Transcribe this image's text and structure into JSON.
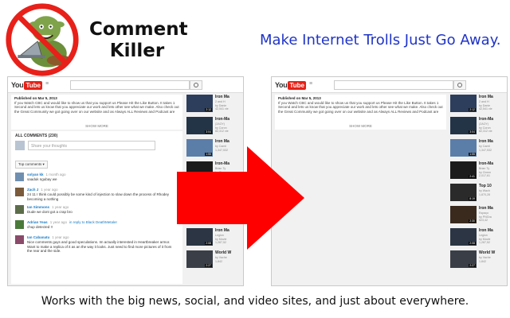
{
  "header": {
    "brand_line1": "Comment",
    "brand_line2": "Killer",
    "tagline": "Make Internet Trolls Just Go Away."
  },
  "footer": "Works with the big news, social, and video sites, and just about everywhere.",
  "colors": {
    "tagline": "#1f34c8",
    "arrow": "#ff0000",
    "youtube_red": "#e62117",
    "link_blue": "#167ac6",
    "no_sign": "#e8201a"
  },
  "browser": {
    "logo_word": "You",
    "logo_tube": "Tube",
    "menu_icon": "≡",
    "description": {
      "published": "Published on Mar 5, 2013",
      "lines": [
        "If you Watch CBC and would like to show us that you support us Please Hit the Like Button. It takes 1",
        "Second and lets us know that you appreciate our work and lets other see what we make. Also check out",
        "the Great Community we got going over on our website and as Always ALL Reviews and Podcast are"
      ],
      "show_more": "SHOW MORE"
    },
    "comments": {
      "header": "ALL COMMENTS (230)",
      "share_placeholder": "Share your thoughts",
      "sort_label": "Top comments ▾",
      "items": [
        {
          "author": "solyan kk",
          "time": "1 month ago",
          "reply": "",
          "lines": [
            "saaduk ngubay we"
          ],
          "color": "#6f8fb0"
        },
        {
          "author": "Zach J",
          "time": "1 year ago",
          "reply": "",
          "lines": [
            "24 11 I think could possibly be some kind of injection to slow down the process of Rhodey",
            "becoming a nothing"
          ],
          "color": "#7a5a3a"
        },
        {
          "author": "Ian Simmons",
          "time": "1 year ago",
          "reply": "",
          "lines": [
            "Dude we dont got a crap bro"
          ],
          "color": "#5c6d4a"
        },
        {
          "author": "Adrian Yeas",
          "time": "1 year ago",
          "reply": "in reply to Black DeathMetaler",
          "lines": [
            "chup detected !!"
          ],
          "color": "#4a7a3a"
        },
        {
          "author": "Ian Cabanatu",
          "time": "1 year ago",
          "reply": "",
          "lines": [
            "Nice comments guys and good speculations. Im actually interested in Heartbreaker armor.",
            "Want to make a replica of it as an the way it looks. Just need to find more pictures of it from",
            "the rear and the side."
          ],
          "color": "#8a4a6a"
        }
      ]
    },
    "sidebar": [
      {
        "title": "Iron Ma",
        "meta": [
          "2 and H",
          "by Danie",
          "42,541 vie"
        ],
        "time": "2:12",
        "color": "#2c3e5c"
      },
      {
        "title": "Iron-Ma",
        "meta": [
          "(2AOY)",
          "by Coron",
          "82,312 vie"
        ],
        "time": "3:04",
        "color": "#243447"
      },
      {
        "title": "Iron Ma",
        "meta": [
          "by Camil",
          "1,347,532"
        ],
        "time": "1:55",
        "color": "#5a7ea8"
      },
      {
        "title": "Iron-Ma",
        "meta": [
          "Brian Ty",
          "by Cinem",
          "2,017,61"
        ],
        "time": "2:41",
        "color": "#1b1b1b"
      },
      {
        "title": "Top 10",
        "meta": [
          "by Wach",
          "1,870,28"
        ],
        "time": "8:19",
        "color": "#2a2a2a"
      },
      {
        "title": "Iron Ma",
        "meta": [
          "Espaço",
          "by PNGra",
          "523,42"
        ],
        "time": "2:30",
        "color": "#3a2a1e"
      },
      {
        "title": "Iron Ma",
        "meta": [
          "Legion",
          "by Movie",
          "1,287,52"
        ],
        "time": "2:08",
        "color": "#2b3544"
      },
      {
        "title": "World W",
        "meta": [
          "by Vache",
          "1,842"
        ],
        "time": "2:27",
        "color": "#3a3f47"
      }
    ]
  }
}
